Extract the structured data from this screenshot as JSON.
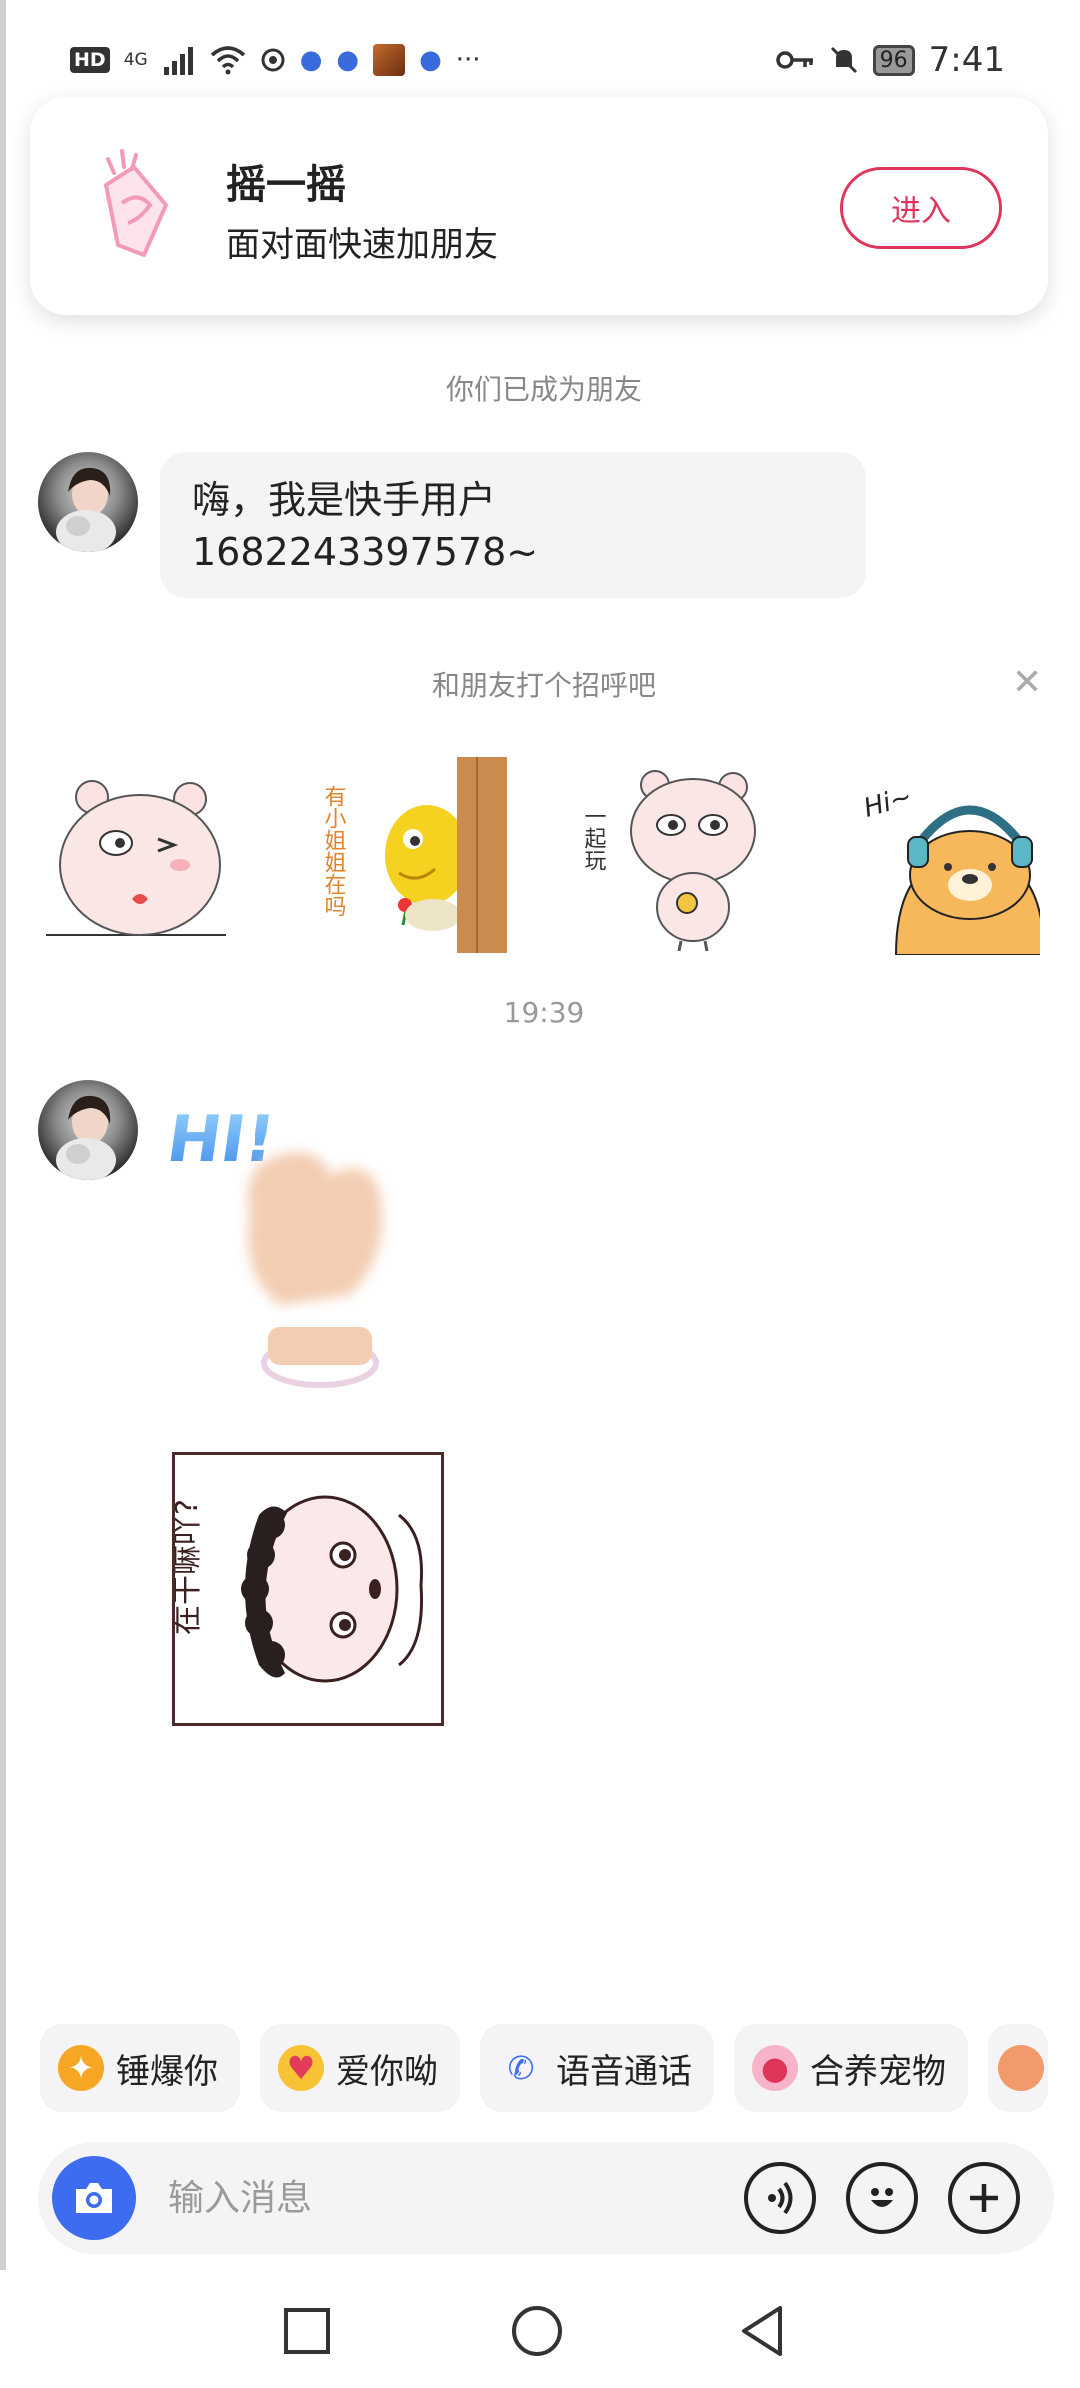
{
  "status_bar": {
    "hd": "HD",
    "network": "4G",
    "battery": "96",
    "time": "7:41",
    "more": "···"
  },
  "banner": {
    "title": "摇一摇",
    "subtitle": "面对面快速加朋友",
    "button": "进入"
  },
  "chat": {
    "friend_notice": "你们已成为朋友",
    "first_message": "嗨，我是快手用户1682243397578~",
    "greet_prompt": "和朋友打个招呼吧",
    "timestamp": "19:39"
  },
  "stickers": {
    "s1": {
      "text": ""
    },
    "s2": {
      "text": "有小姐姐在吗"
    },
    "s3": {
      "text": "一起玩"
    },
    "s4": {
      "text": "Hi~"
    },
    "hi_text": "HI!",
    "box_text": "在干嘛吖?"
  },
  "quick_actions": [
    {
      "label": "锤爆你",
      "icon": "hammer-icon"
    },
    {
      "label": "爱你呦",
      "icon": "heart-eyes-icon"
    },
    {
      "label": "语音通话",
      "icon": "phone-icon"
    },
    {
      "label": "合养宠物",
      "icon": "pet-icon"
    }
  ],
  "input": {
    "placeholder": "输入消息"
  },
  "colors": {
    "accent": "#e0355b",
    "camera": "#3d6cf0",
    "bubble": "#f4f4f6"
  }
}
